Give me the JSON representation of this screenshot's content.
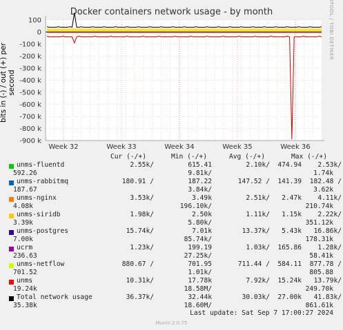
{
  "chart_data": {
    "type": "line",
    "title": "Docker containers network usage - by month",
    "ylabel": "bits in (-) / out (+) per second",
    "yticks": [
      "100",
      "0",
      "-100 k",
      "-200 k",
      "-300 k",
      "-400 k",
      "-500 k",
      "-600 k",
      "-700 k",
      "-800 k",
      "-900 k"
    ],
    "ylim": [
      -900000,
      100000
    ],
    "xticks": [
      "Week 32",
      "Week 33",
      "Week 34",
      "Week 35",
      "Week 36"
    ],
    "grid": true,
    "series": [
      {
        "name": "unms",
        "color": "#cc0000",
        "in_baseline": -40000,
        "spike": {
          "x": "Week 36",
          "value": -890000
        }
      },
      {
        "name": "Total network usage",
        "color": "#000000",
        "out_baseline": 40000
      }
    ]
  },
  "side_label": "RRDTOOL / TOBI OETIKER",
  "legend": {
    "headers": {
      "cur": "Cur (-/+)",
      "min": "Min (-/+)",
      "avg": "Avg (-/+)",
      "max": "Max (-/+)"
    },
    "rows": [
      {
        "name": "unms-fluentd",
        "color": "#00cc00",
        "cur": "2.55k/",
        "cur2": "592.26",
        "min": "615.41",
        "min2": "9.81k/",
        "avg": "2.10k/",
        "avg2": "474.94",
        "max": "2.53k/",
        "max2": "1.74k"
      },
      {
        "name": "unms-rabbitmq",
        "color": "#0066b3",
        "cur": "180.91 /",
        "cur2": "187.67",
        "min": "187.22",
        "min2": "3.84k/",
        "avg": "147.52 /",
        "avg2": "141.39",
        "max": "182.48 /",
        "max2": "3.62k"
      },
      {
        "name": "unms-nginx",
        "color": "#ff8000",
        "cur": "3.53k/",
        "cur2": "4.08k",
        "min": "3.49k",
        "min2": "196.10k/",
        "avg": "2.51k/",
        "avg2": "2.47k",
        "max": "4.11k/",
        "max2": "210.74k"
      },
      {
        "name": "unms-siridb",
        "color": "#ffcc00",
        "cur": "1.98k/",
        "cur2": "3.39k",
        "min": "2.50k",
        "min2": "5.80k/",
        "avg": "1.11k/",
        "avg2": "1.15k",
        "max": "2.22k/",
        "max2": "351.12k"
      },
      {
        "name": "unms-postgres",
        "color": "#330099",
        "cur": "15.74k/",
        "cur2": "7.00k",
        "min": "7.01k",
        "min2": "85.74k/",
        "avg": "13.37k/",
        "avg2": "5.43k",
        "max": "16.86k/",
        "max2": "178.31k"
      },
      {
        "name": "ucrm",
        "color": "#990099",
        "cur": "1.23k/",
        "cur2": "236.63",
        "min": "199.19",
        "min2": "27.25k/",
        "avg": "1.03k/",
        "avg2": "165.86",
        "max": "1.28k/",
        "max2": "58.41k"
      },
      {
        "name": "unms-netflow",
        "color": "#ccff00",
        "cur": "880.67 /",
        "cur2": "701.52",
        "min": "701.95",
        "min2": "1.01k/",
        "avg": "711.44 /",
        "avg2": "584.11",
        "max": "877.78 /",
        "max2": "805.88"
      },
      {
        "name": "unms",
        "color": "#ff0000",
        "cur": "10.31k/",
        "cur2": "19.24k",
        "min": "17.78k",
        "min2": "18.58M/",
        "avg": "7.92k/",
        "avg2": "15.24k",
        "max": "13.79k/",
        "max2": "249.70k"
      },
      {
        "name": "Total network usage",
        "color": "#000000",
        "cur": "36.37k/",
        "cur2": "35.38k",
        "min": "32.44k",
        "min2": "18.60M/",
        "avg": "30.03k/",
        "avg2": "27.00k",
        "max": "41.83k/",
        "max2": "861.61k"
      }
    ]
  },
  "footer": "Last update: Sat Sep  7 17:00:27 2024",
  "munin": "Munin 2.0.75"
}
